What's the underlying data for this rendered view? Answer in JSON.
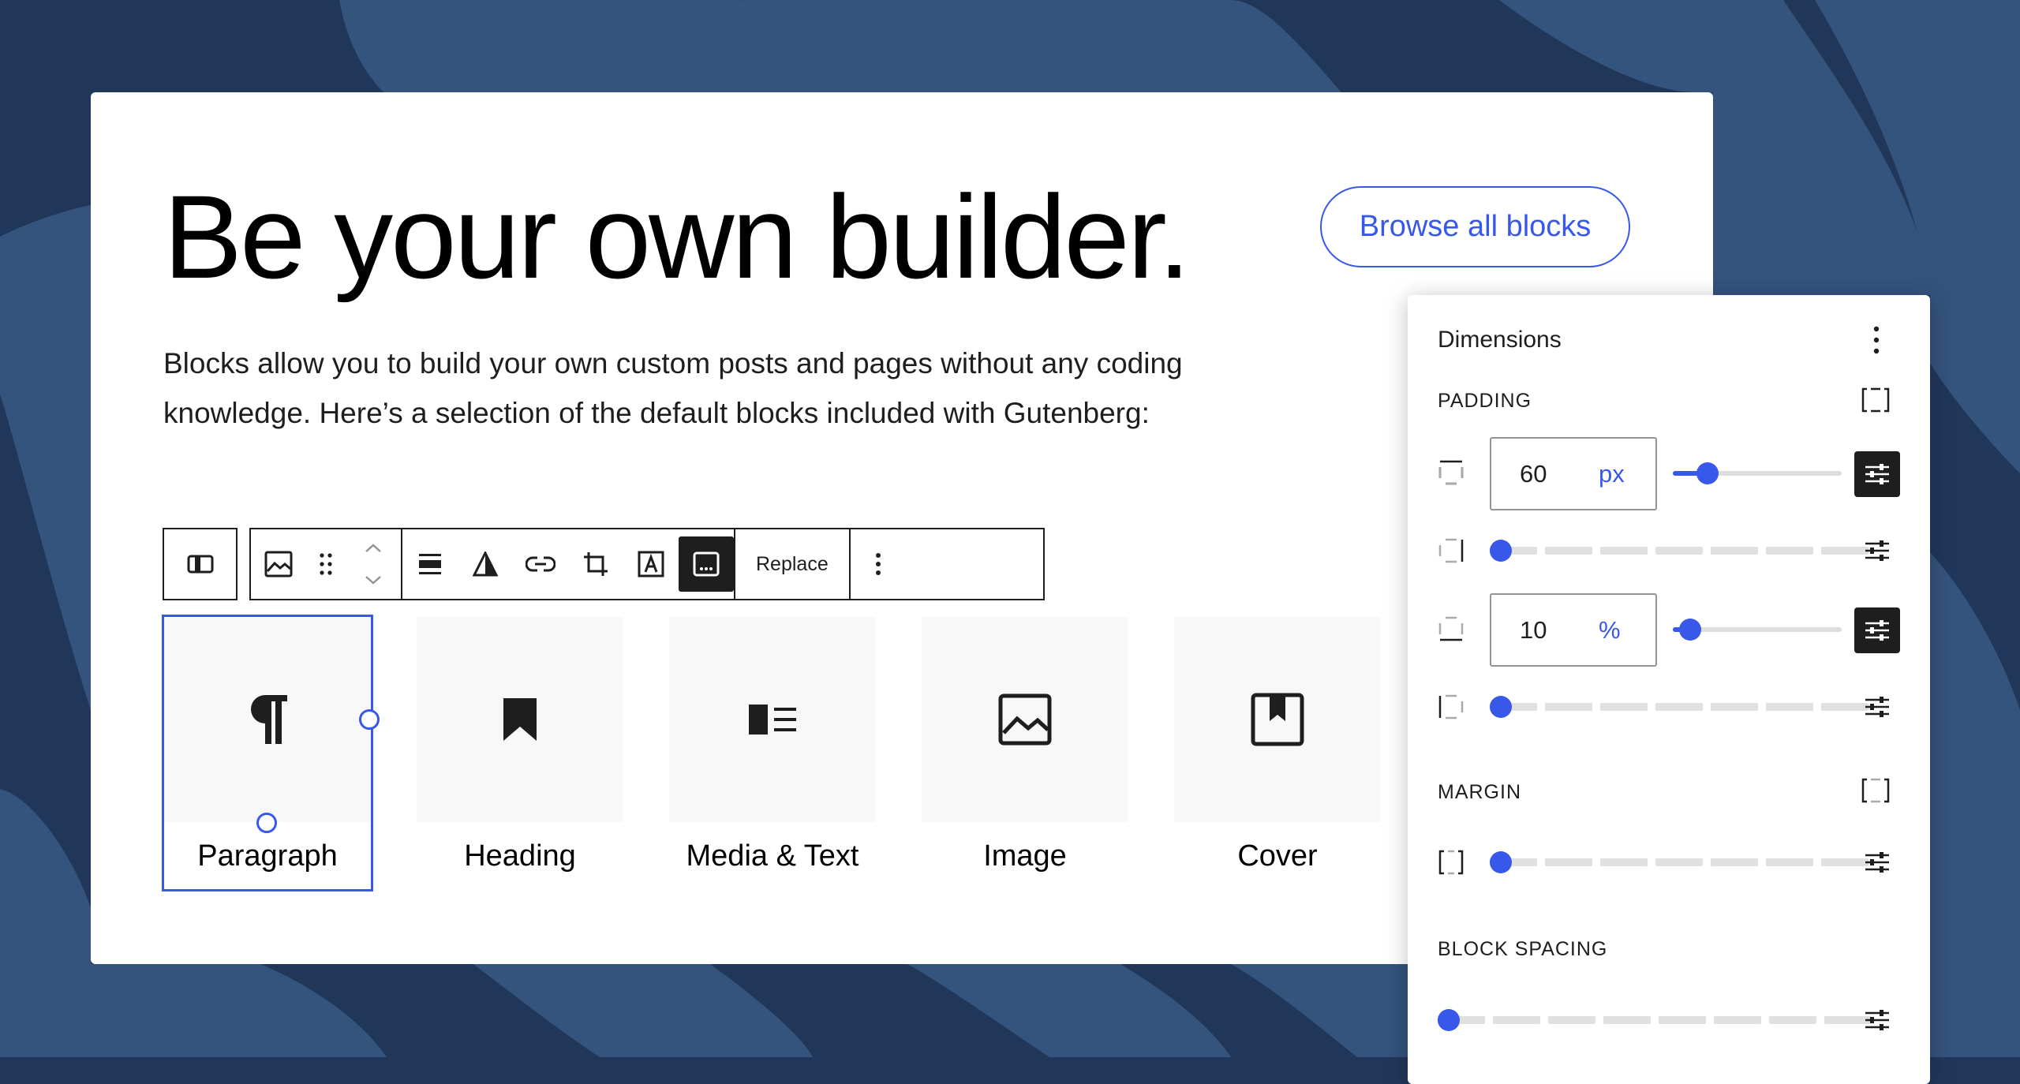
{
  "hero": {
    "title": "Be your own builder.",
    "browse_button": "Browse all blocks",
    "intro": "Blocks allow you to build your own custom posts and pages without any coding knowledge. Here’s a selection of the default blocks included with Gutenberg:"
  },
  "toolbar": {
    "replace_label": "Replace",
    "buttons": [
      "block-layout-icon",
      "image-icon",
      "drag-handle-icon",
      "move-arrows-icon",
      "align-icon",
      "duotone-icon",
      "link-icon",
      "crop-icon",
      "text-overlay-icon",
      "caption-icon",
      "more-options-icon"
    ]
  },
  "blocks": [
    {
      "label": "Paragraph",
      "icon": "paragraph-icon",
      "selected": true
    },
    {
      "label": "Heading",
      "icon": "bookmark-icon",
      "selected": false
    },
    {
      "label": "Media & Text",
      "icon": "media-text-icon",
      "selected": false
    },
    {
      "label": "Image",
      "icon": "image-icon",
      "selected": false
    },
    {
      "label": "Cover",
      "icon": "cover-icon",
      "selected": false
    }
  ],
  "dimensions": {
    "title": "Dimensions",
    "padding_label": "PADDING",
    "margin_label": "MARGIN",
    "block_spacing_label": "BLOCK SPACING",
    "padding_rows": [
      {
        "value": "60",
        "unit": "px",
        "slider": 0.2
      },
      {
        "slider": 0
      },
      {
        "value": "10",
        "unit": "%",
        "slider": 0.1
      },
      {
        "slider": 0
      }
    ],
    "margin_slider": 0,
    "block_spacing_slider": 0
  },
  "colors": {
    "background": "#21375a",
    "accent": "#3858e9",
    "text": "#1e1e1e"
  }
}
